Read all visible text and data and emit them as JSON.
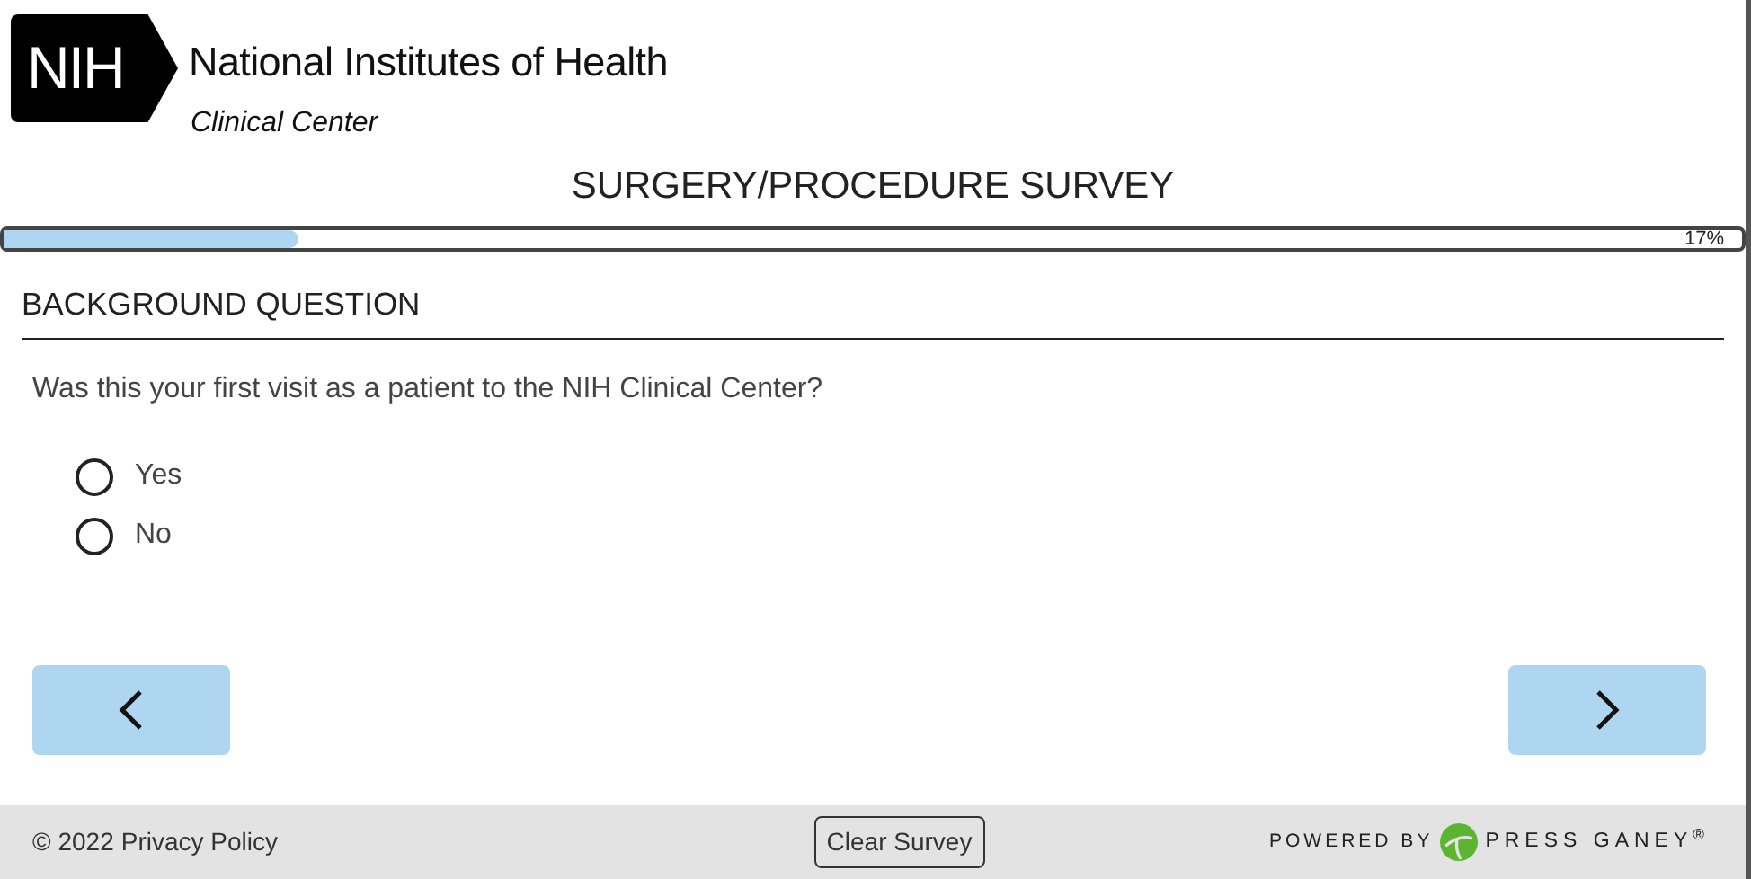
{
  "header": {
    "logo_mark": "NIH",
    "organization": "National Institutes of Health",
    "department": "Clinical Center"
  },
  "title": "SURGERY/PROCEDURE SURVEY",
  "progress": {
    "level": 0.17,
    "reading": "17%"
  },
  "section": "BACKGROUND QUESTION",
  "question": "Was this your first visit as a patient to the NIH Clinical Center?",
  "options": [
    {
      "label": "Yes",
      "selected": false
    },
    {
      "label": "No",
      "selected": false
    }
  ],
  "footer": {
    "copyright": "© 2022",
    "privacy_link": "Privacy Policy",
    "clear_button": "Clear Survey",
    "powered_by": "POWERED BY",
    "brand": "PRESS GANEY$^{®}$"
  }
}
